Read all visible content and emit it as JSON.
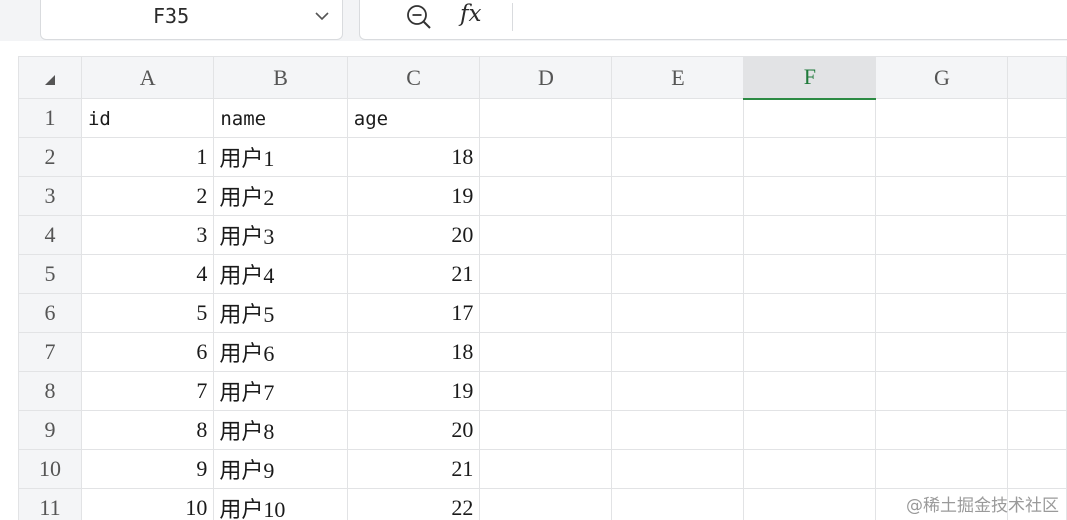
{
  "namebox": {
    "value": "F35"
  },
  "formula_bar": {
    "fx_label": "fx",
    "value": ""
  },
  "columns": [
    "A",
    "B",
    "C",
    "D",
    "E",
    "F",
    "G"
  ],
  "selected_column": "F",
  "rows": [
    {
      "num": "1",
      "cells": [
        "id",
        "name",
        "age",
        "",
        "",
        "",
        ""
      ]
    },
    {
      "num": "2",
      "cells": [
        "1",
        "用户1",
        "18",
        "",
        "",
        "",
        ""
      ]
    },
    {
      "num": "3",
      "cells": [
        "2",
        "用户2",
        "19",
        "",
        "",
        "",
        ""
      ]
    },
    {
      "num": "4",
      "cells": [
        "3",
        "用户3",
        "20",
        "",
        "",
        "",
        ""
      ]
    },
    {
      "num": "5",
      "cells": [
        "4",
        "用户4",
        "21",
        "",
        "",
        "",
        ""
      ]
    },
    {
      "num": "6",
      "cells": [
        "5",
        "用户5",
        "17",
        "",
        "",
        "",
        ""
      ]
    },
    {
      "num": "7",
      "cells": [
        "6",
        "用户6",
        "18",
        "",
        "",
        "",
        ""
      ]
    },
    {
      "num": "8",
      "cells": [
        "7",
        "用户7",
        "19",
        "",
        "",
        "",
        ""
      ]
    },
    {
      "num": "9",
      "cells": [
        "8",
        "用户8",
        "20",
        "",
        "",
        "",
        ""
      ]
    },
    {
      "num": "10",
      "cells": [
        "9",
        "用户9",
        "21",
        "",
        "",
        "",
        ""
      ]
    },
    {
      "num": "11",
      "cells": [
        "10",
        "用户10",
        "22",
        "",
        "",
        "",
        ""
      ]
    }
  ],
  "watermark": "@稀土掘金技术社区",
  "colors": {
    "selection_green": "#2c8a43",
    "header_bg": "#f4f5f7",
    "gridline": "#e2e3e5"
  },
  "icons": {
    "namebox_dropdown": "chevron-down-icon",
    "zoom": "zoom-out-icon",
    "function": "fx-icon",
    "select_all": "select-all-triangle-icon"
  }
}
